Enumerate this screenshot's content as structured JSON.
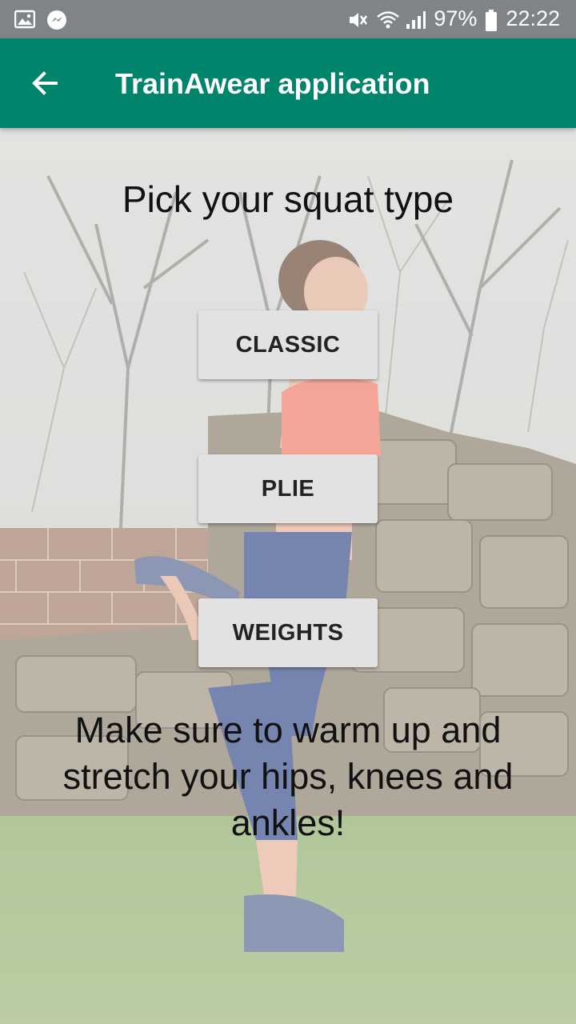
{
  "status_bar": {
    "left_icons": [
      "image-icon",
      "messenger-icon"
    ],
    "right_icons": [
      "mute-icon",
      "wifi-icon",
      "signal-icon"
    ],
    "battery": "97%",
    "time": "22:22"
  },
  "app_bar": {
    "back_icon": "arrow-back-icon",
    "title": "TrainAwear application"
  },
  "main": {
    "heading": "Pick your squat type",
    "buttons": [
      {
        "label": "CLASSIC"
      },
      {
        "label": "PLIE"
      },
      {
        "label": "WEIGHTS"
      }
    ],
    "tip": "Make sure to warm up and stretch your hips, knees and ankles!"
  },
  "colors": {
    "app_bar": "#00846c",
    "status_bar": "#7f8486",
    "button_bg": "#e2e2e2"
  }
}
